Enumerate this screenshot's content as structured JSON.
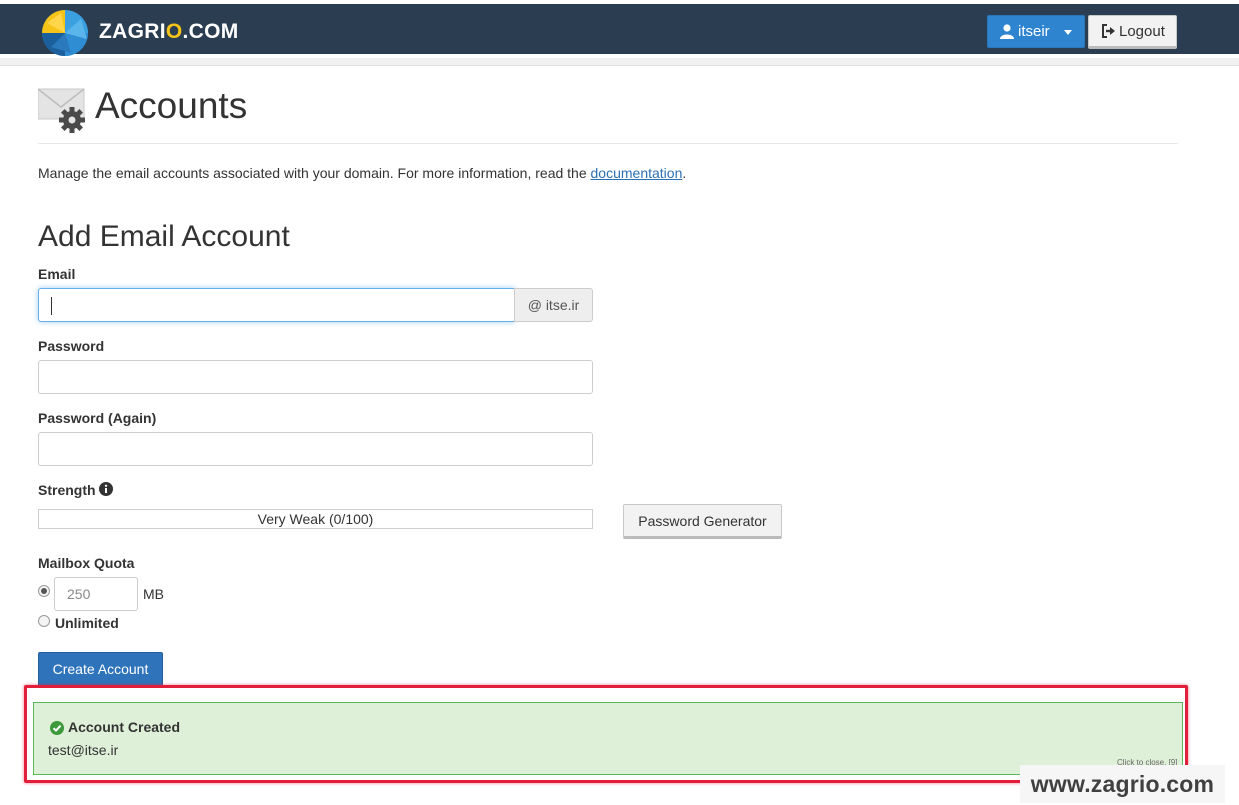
{
  "header": {
    "brand_prefix": "ZAGRI",
    "brand_accent": "O",
    "brand_suffix": ".COM",
    "user_label": "itseir",
    "logout_label": "Logout",
    "bar_color": "#2b3e51",
    "user_button_color": "#2f84d0"
  },
  "page": {
    "title": "Accounts",
    "description_prefix": "Manage the email accounts associated with your domain. For more information, read the ",
    "description_link": "documentation",
    "description_suffix": "."
  },
  "form": {
    "title": "Add Email Account",
    "email_label": "Email",
    "email_value": "",
    "domain_addon": "@ itse.ir",
    "password_label": "Password",
    "password_again_label": "Password (Again)",
    "strength_label": "Strength",
    "strength_value": "Very Weak (0/100)",
    "strength_score": 0,
    "password_generator_label": "Password Generator",
    "quota_label": "Mailbox Quota",
    "quota_value": "250",
    "quota_unit": "MB",
    "quota_selected": "limited",
    "unlimited_label": "Unlimited",
    "create_label": "Create Account"
  },
  "alert": {
    "title": "Account Created",
    "body": "test@itse.ir",
    "close_text": "Click to close. [9]",
    "background_color": "#dff0d8",
    "highlight_color": "#e11f3b"
  },
  "watermark": {
    "text": "www.zagrio.com"
  }
}
